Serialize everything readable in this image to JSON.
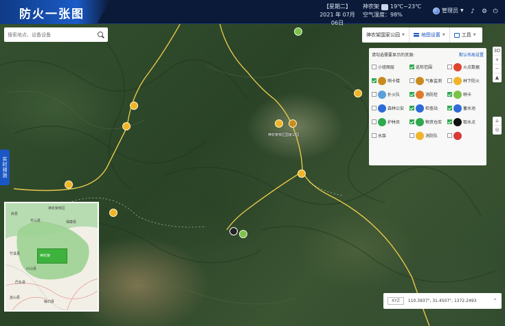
{
  "header": {
    "title": "防火一张图",
    "weekday": "【星期二】",
    "date": "2021 年 07月 06日",
    "weather_prefix": "神农架",
    "temperature": "19℃~23℃",
    "air_quality": "空气湿度：98%",
    "user_name": "管理员"
  },
  "search": {
    "placeholder": "搜索地点、设备设备"
  },
  "realtime_tab": "实时预测",
  "toolbar": {
    "location": "神农架国家公园",
    "layers": "地图设置",
    "tools": "工具"
  },
  "layer_panel": {
    "prompt": "请勾选需要显示的资源:",
    "reset_link": "默认布局设置",
    "items": [
      {
        "label": "小班图层",
        "checked": false,
        "color": "",
        "icon": "none"
      },
      {
        "label": "巡检范围",
        "checked": true,
        "color": "",
        "icon": "none"
      },
      {
        "label": "火点数据",
        "checked": false,
        "color": "#e0442c",
        "icon": "flame-icon"
      },
      {
        "label": "哨卡楼",
        "checked": true,
        "color": "#c98a1e",
        "icon": "tower-icon"
      },
      {
        "label": "气象监测",
        "checked": false,
        "color": "#c98a1e",
        "icon": "weather-station-icon"
      },
      {
        "label": "林下防火",
        "checked": false,
        "color": "#f0b429",
        "icon": "forest-icon"
      },
      {
        "label": "扑火队",
        "checked": false,
        "color": "#5aa0d8",
        "icon": "team-icon"
      },
      {
        "label": "消防栓",
        "checked": true,
        "color": "#e07a2c",
        "icon": "hydrant-icon"
      },
      {
        "label": "哨卡",
        "checked": true,
        "color": "#7cc24a",
        "icon": "checkpoint-icon"
      },
      {
        "label": "森林公安",
        "checked": false,
        "color": "#2c6bd8",
        "icon": "police-icon"
      },
      {
        "label": "检查站",
        "checked": true,
        "color": "#2c6bd8",
        "icon": "inspection-icon"
      },
      {
        "label": "蓄水池",
        "checked": true,
        "color": "#2c6bd8",
        "icon": "reservoir-icon"
      },
      {
        "label": "护林员",
        "checked": false,
        "color": "#2fa84f",
        "icon": "ranger-icon"
      },
      {
        "label": "物资仓库",
        "checked": true,
        "color": "#2fa84f",
        "icon": "warehouse-icon"
      },
      {
        "label": "取水点",
        "checked": true,
        "color": "#111111",
        "icon": "water-point-icon"
      },
      {
        "label": "水泵",
        "checked": false,
        "color": "",
        "icon": "none"
      },
      {
        "label": "消防队",
        "checked": false,
        "color": "#f0b429",
        "icon": "fire-brigade-icon"
      },
      {
        "label": "",
        "checked": false,
        "color": "#d83a3a",
        "icon": "hospital-icon"
      }
    ]
  },
  "map": {
    "center_label": "神农架林区国家公园",
    "coordinates": "110.3937°, 31.4507°, 1372.2493",
    "coord_system": "XYZ"
  },
  "minimap": {
    "labels": [
      "神农架林区",
      "房县",
      "竹山县",
      "巴东县",
      "兴山县",
      "神农架",
      "保康县",
      "竹溪县",
      "巫山县",
      "秭归县"
    ]
  },
  "controls": {
    "view_mode": "3D",
    "zoom_in": "+",
    "zoom_out": "−",
    "compass": "▲"
  }
}
